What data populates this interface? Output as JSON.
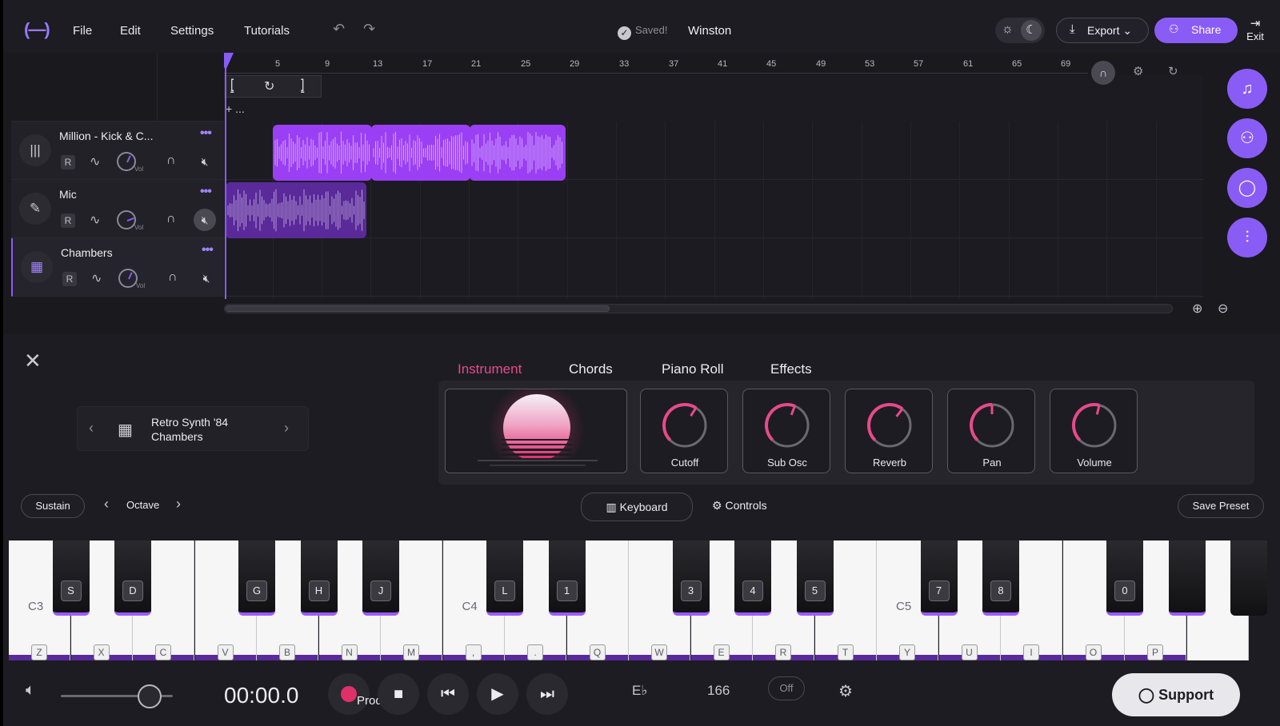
{
  "topbar": {
    "logo": "(—)",
    "menus": [
      "File",
      "Edit",
      "Settings",
      "Tutorials"
    ],
    "saved_label": "Saved!",
    "project_name": "Winston",
    "export_label": "Export",
    "share_label": "Share",
    "exit_label": "Exit"
  },
  "ruler": {
    "ticks": [
      "5",
      "9",
      "13",
      "17",
      "21",
      "25",
      "29",
      "33",
      "37",
      "41",
      "45",
      "49",
      "53",
      "57",
      "61",
      "65",
      "69"
    ],
    "add_label": "+ ..."
  },
  "tracks": [
    {
      "name": "Million - Kick & C...",
      "icon": "waveform-icon",
      "r_label": "R",
      "vol_label": "Vol",
      "muted": false
    },
    {
      "name": "Mic",
      "icon": "microphone-icon",
      "r_label": "R",
      "vol_label": "Vol",
      "muted": true
    },
    {
      "name": "Chambers",
      "icon": "keyboard-instrument-icon",
      "r_label": "R",
      "vol_label": "Vol",
      "muted": false
    }
  ],
  "instrument_panel": {
    "tabs": [
      "Instrument",
      "Chords",
      "Piano Roll",
      "Effects"
    ],
    "active_tab": "Instrument",
    "preset": {
      "name": "Retro Synth '84",
      "track": "Chambers"
    },
    "knobs": [
      {
        "label": "Cutoff",
        "value": 0.62
      },
      {
        "label": "Sub Osc",
        "value": 0.58
      },
      {
        "label": "Reverb",
        "value": 0.64
      },
      {
        "label": "Pan",
        "value": 0.5
      },
      {
        "label": "Volume",
        "value": 0.55
      }
    ],
    "sustain_label": "Sustain",
    "octave_label": "Octave",
    "keyboard_label": "Keyboard",
    "controls_label": "Controls",
    "save_preset_label": "Save Preset"
  },
  "keyboard": {
    "octave_labels": [
      "C3",
      "C4",
      "C5"
    ],
    "white_keys": [
      "Z",
      "X",
      "C",
      "V",
      "B",
      "N",
      "M",
      ",",
      ".",
      "Q",
      "W",
      "E",
      "R",
      "T",
      "Y",
      "U",
      "I",
      "O",
      "P",
      ""
    ],
    "black_keys": [
      "S",
      "D",
      "G",
      "H",
      "J",
      "L",
      "1",
      "3",
      "4",
      "5",
      "7",
      "8",
      "0",
      "",
      ""
    ]
  },
  "transport": {
    "time": "00:00.0",
    "producer_label": "Producer",
    "key": "E♭",
    "bpm": "166",
    "metronome": "Off",
    "support_label": "Support"
  },
  "colors": {
    "accent": "#8a5cf6",
    "clip": "#9b3ff5",
    "tab_active": "#e64a8c",
    "background": "#1c1b20"
  }
}
